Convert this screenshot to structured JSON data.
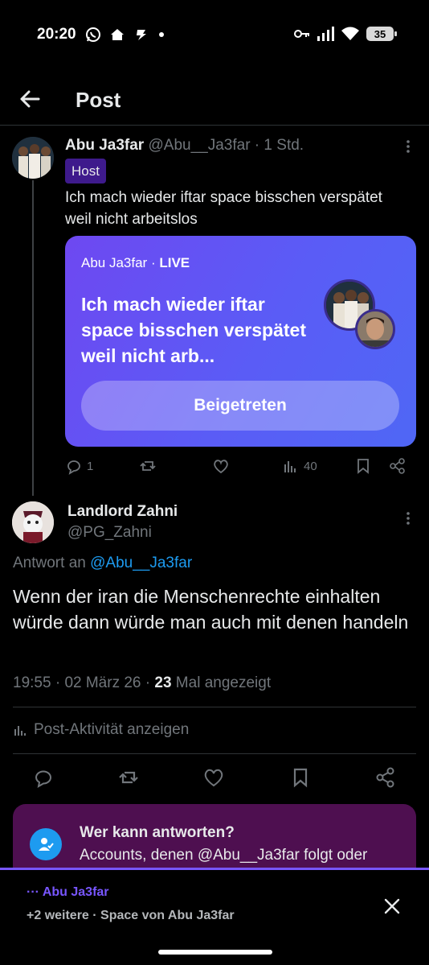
{
  "status_bar": {
    "time": "20:20",
    "battery": "35",
    "icons": [
      "whatsapp-icon",
      "home-icon",
      "amazon-icon",
      "dot-icon",
      "key-icon",
      "signal-icon",
      "wifi-icon",
      "battery-icon"
    ]
  },
  "header": {
    "title": "Post"
  },
  "parent_post": {
    "name": "Abu Ja3far",
    "handle": "@Abu__Ja3far",
    "separator": " · ",
    "time": "1 Std.",
    "badge": "Host",
    "text": "Ich mach wieder iftar space bisschen verspätet weil nicht arbeitslos",
    "space": {
      "host": "Abu Ja3far",
      "dot": " · ",
      "live": "LIVE",
      "title": "Ich mach wieder iftar space bisschen verspätet weil nicht arb...",
      "button": "Beigetreten"
    },
    "actions": {
      "replies": "1",
      "views": "40"
    }
  },
  "main_post": {
    "name": "Landlord Zahni",
    "handle": "@PG_Zahni",
    "reply_prefix": "Antwort an ",
    "reply_to": "@Abu__Ja3far",
    "text": "Wenn der iran die Menschenrechte einhalten würde dann würde man auch mit denen handeln",
    "time": "19:55",
    "date": "02 März 26",
    "views_count": "23",
    "views_label": "Mal angezeigt",
    "dot": " · ",
    "activity": "Post-Aktivität anzeigen"
  },
  "who_can_reply": {
    "title": "Wer kann antworten?",
    "description": "Accounts, denen @Abu__Ja3far folgt oder"
  },
  "space_bar": {
    "host": "··· Abu Ja3far",
    "subtitle": "+2 weitere · Space von Abu Ja3far"
  },
  "colors": {
    "accent": "#1d9bf0",
    "space_purple": "#7856ff",
    "host_badge": "#3e1a8c",
    "reply_card": "#4e0f50"
  }
}
